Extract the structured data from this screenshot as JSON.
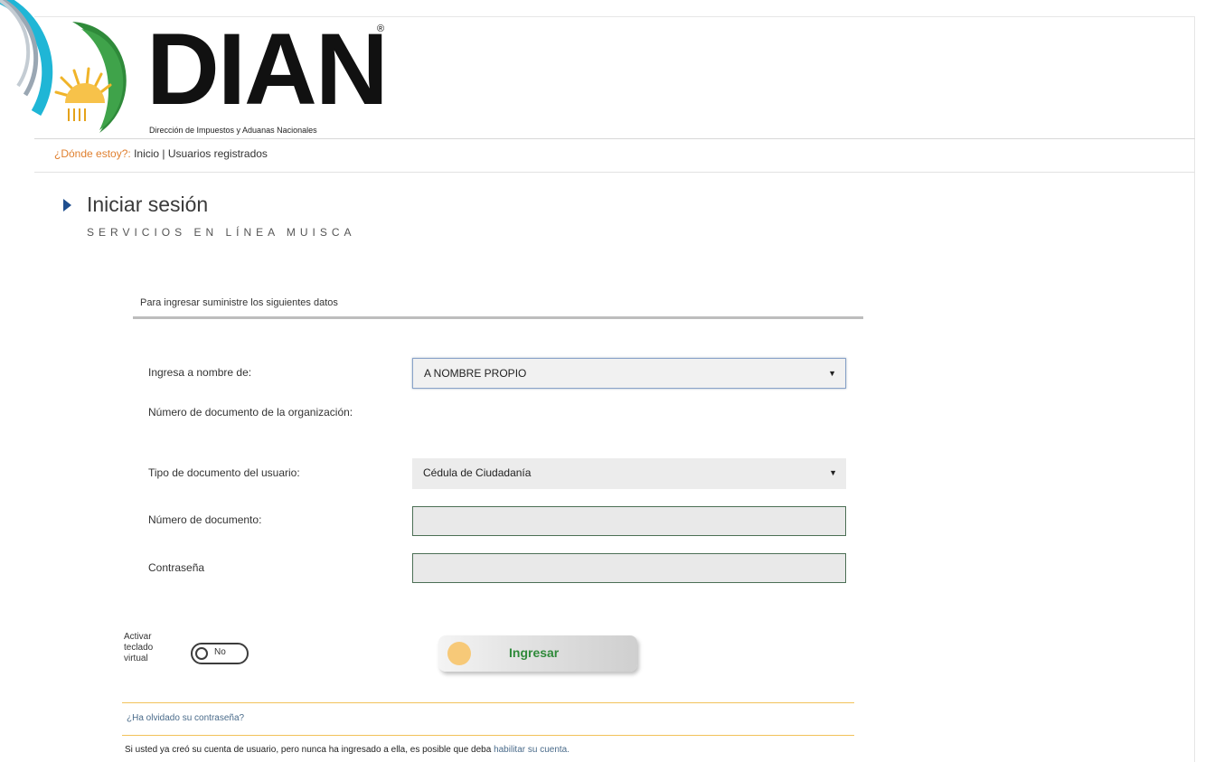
{
  "header": {
    "logo_text": "DIAN",
    "logo_registered": "®",
    "logo_subtitle": "Dirección de Impuestos y Aduanas Nacionales"
  },
  "breadcrumb": {
    "prefix": "¿Dónde estoy?:",
    "home": "Inicio",
    "separator": "|",
    "current": "Usuarios registrados"
  },
  "page": {
    "title": "Iniciar sesión",
    "subtitle": "SERVICIOS EN LÍNEA MUISCA"
  },
  "form": {
    "intro": "Para ingresar suministre los siguientes datos",
    "on_behalf_label": "Ingresa a nombre de:",
    "on_behalf_value": "A NOMBRE PROPIO",
    "org_doc_label": "Número de documento de la organización:",
    "doc_type_label": "Tipo de documento del usuario:",
    "doc_type_value": "Cédula de Ciudadanía",
    "doc_number_label": "Número de documento:",
    "doc_number_value": "",
    "password_label": "Contraseña",
    "password_value": ""
  },
  "keyboard": {
    "label": "Activar teclado virtual",
    "toggle_text": "No"
  },
  "submit": {
    "label": "Ingresar"
  },
  "footer": {
    "forgot_password": "¿Ha olvidado su contraseña?",
    "note_text": "Si usted ya creó su cuenta de usuario, pero nunca ha ingresado a ella, es posible que deba ",
    "note_link": "habilitar su cuenta."
  },
  "colors": {
    "dian_green": "#2f8a3a",
    "breadcrumb_orange": "#e08030",
    "title_arrow_blue": "#1f4f8f",
    "divider_yellow": "#f2c25a",
    "accent_cyan": "#1fb6d6"
  }
}
